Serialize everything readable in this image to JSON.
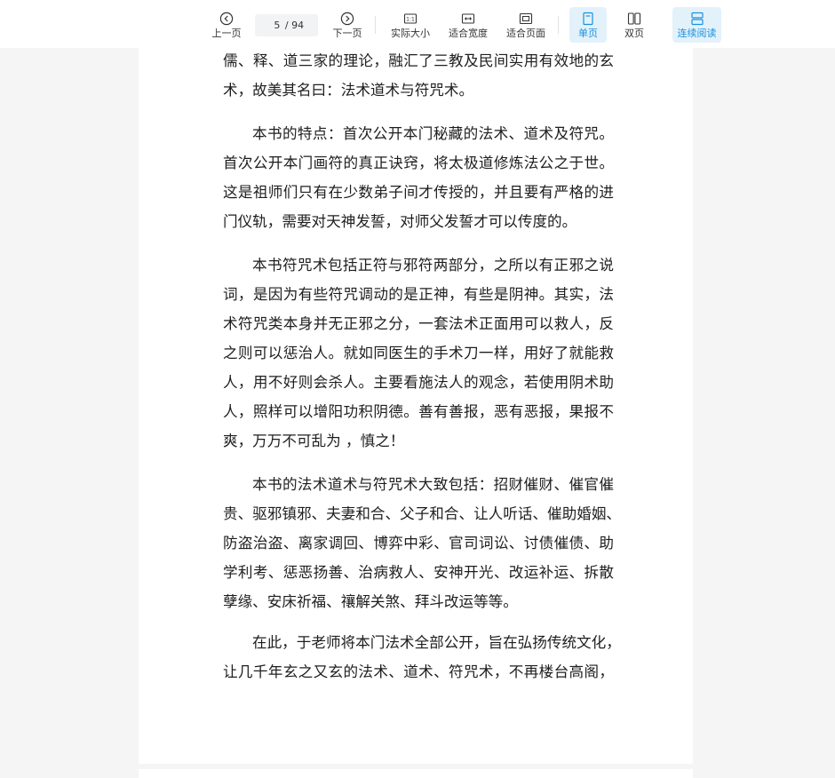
{
  "toolbar": {
    "prev_label": "上一页",
    "current_page": "5",
    "total_pages": "/ 94",
    "next_label": "下一页",
    "actual_size_label": "实际大小",
    "fit_width_label": "适合宽度",
    "fit_page_label": "适合页面",
    "single_page_label": "单页",
    "double_page_label": "双页",
    "continuous_label": "连续阅读",
    "accent_color": "#1a91dd"
  },
  "document": {
    "lines": [
      "儒、释、道三家的理论，融汇了三教及民间实用有效地的玄",
      "术，故美其名曰：法术道术与符咒术。",
      "本书的特点：首次公开本门秘藏的法术、道术及符咒。",
      "首次公开本门画符的真正诀窍，将太极道修炼法公之于世。",
      "这是祖师们只有在少数弟子间才传授的，并且要有严格的进",
      "门仪轨，需要对天神发誓，对师父发誓才可以传度的。",
      "本书符咒术包括正符与邪符两部分，之所以有正邪之说",
      "词，是因为有些符咒调动的是正神，有些是阴神。其实，法",
      "术符咒类本身并无正邪之分，一套法术正面用可以救人，反",
      "之则可以惩治人。就如同医生的手术刀一样，用好了就能救",
      "人，用不好则会杀人。主要看施法人的观念，若使用阴术助",
      "人，照样可以增阳功积阴德。善有善报，恶有恶报，果报不",
      "爽，万万不可乱为 ，慎之！",
      "本书的法术道术与符咒术大致包括：招财催财、催官催",
      "贵、驱邪镇邪、夫妻和合、父子和合、让人听话、催助婚姻、",
      "防盗治盗、离家调回、博弈中彩、官司词讼、讨债催债、助",
      "学利考、惩恶扬善、治病救人、安神开光、改运补运、拆散",
      "孽缘、安床祈福、禳解关煞、拜斗改运等等。",
      "在此，于老师将本门法术全部公开，旨在弘扬传统文化，",
      "让几千年玄之又玄的法术、道术、符咒术，不再楼台高阁，"
    ]
  }
}
